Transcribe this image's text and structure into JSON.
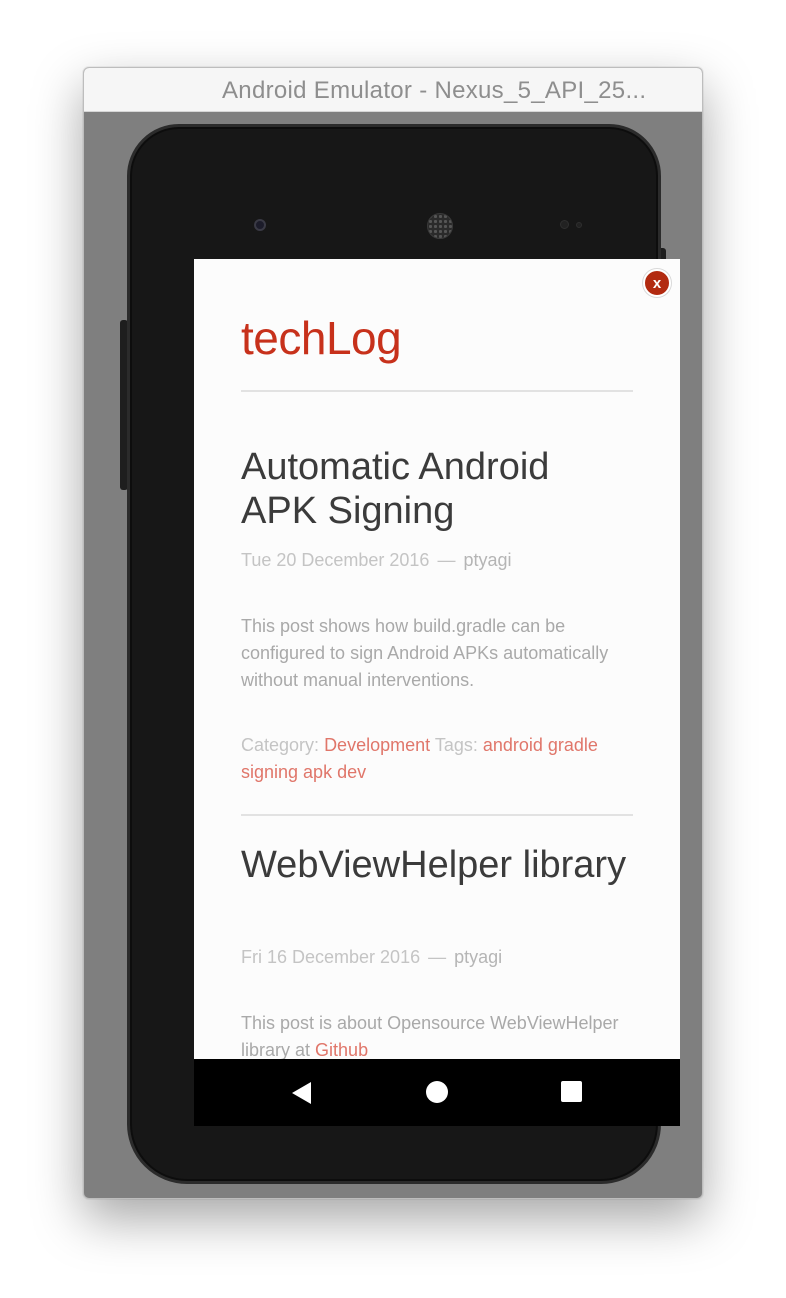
{
  "window": {
    "title": "Android Emulator - Nexus_5_API_25..."
  },
  "browser_overlay": {
    "close_label": "x"
  },
  "site": {
    "title": "techLog"
  },
  "posts": [
    {
      "title": "Automatic Android APK Signing",
      "date": "Tue 20 December 2016",
      "separator": "—",
      "author": "ptyagi",
      "summary": "This post shows how build.gradle can be configured to sign Android APKs automatically without manual interventions.",
      "category_label": "Category:",
      "category": "Development",
      "tags_label": "Tags:",
      "tags": "android gradle signing apk dev"
    },
    {
      "title": "WebViewHelper library",
      "date": "Fri 16 December 2016",
      "separator": "—",
      "author": "ptyagi",
      "summary_prefix": "This post is about Opensource WebViewHelper library at",
      "summary_link": "Github"
    }
  ],
  "nav_bar": {
    "buttons": [
      "back",
      "home",
      "recents"
    ]
  }
}
